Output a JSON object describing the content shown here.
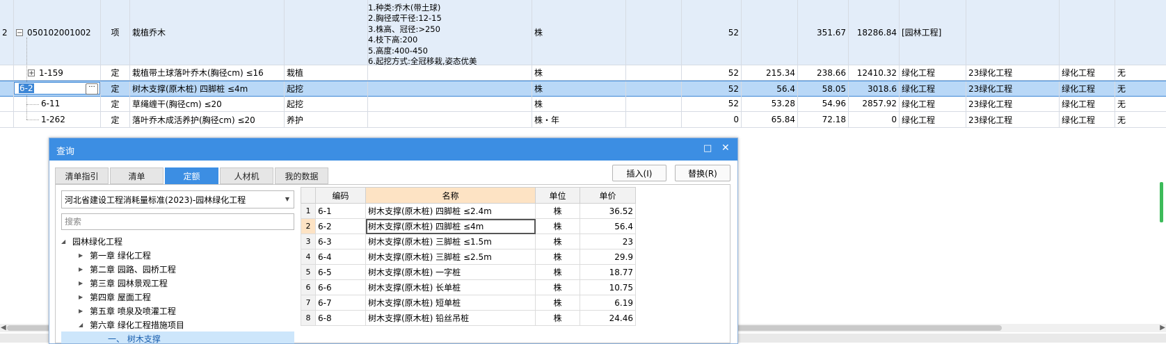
{
  "bill_row": {
    "row_no": "2",
    "code": "050102001002",
    "type": "项",
    "name": "栽植乔木",
    "features": [
      "1.种类:乔木(带土球)",
      "2.胸径或干径:12-15",
      "3.株高、冠径:>250",
      "4.枝下高:200",
      "5.高度:400-450",
      "6.起挖方式:全冠移栽,姿态优美"
    ],
    "unit": "株",
    "qty": "52",
    "unit_price": "351.67",
    "total": "18286.84",
    "category": "[园林工程]"
  },
  "quota_rows": [
    {
      "code": "1-159",
      "type": "定",
      "name": "栽植带土球落叶乔木(胸径cm) ≤16",
      "work": "栽植",
      "unit": "株",
      "qty": "52",
      "price": "215.34",
      "comp": "238.66",
      "total": "12410.32",
      "cat": "绿化工程",
      "prof": "23绿化工程",
      "sub": "绿化工程",
      "extra": "无"
    },
    {
      "code": "6-2",
      "type": "定",
      "name": "树木支撑(原木桩) 四脚桩 ≤4m",
      "work": "起挖",
      "unit": "株",
      "qty": "52",
      "price": "56.4",
      "comp": "58.05",
      "total": "3018.6",
      "cat": "绿化工程",
      "prof": "23绿化工程",
      "sub": "绿化工程",
      "extra": "无"
    },
    {
      "code": "6-11",
      "type": "定",
      "name": "草绳缠干(胸径cm) ≤20",
      "work": "起挖",
      "unit": "株",
      "qty": "52",
      "price": "53.28",
      "comp": "54.96",
      "total": "2857.92",
      "cat": "绿化工程",
      "prof": "23绿化工程",
      "sub": "绿化工程",
      "extra": "无"
    },
    {
      "code": "1-262",
      "type": "定",
      "name": "落叶乔木成活养护(胸径cm) ≤20",
      "work": "养护",
      "unit": "株・年",
      "qty": "0",
      "price": "65.84",
      "comp": "72.18",
      "total": "0",
      "cat": "绿化工程",
      "prof": "23绿化工程",
      "sub": "绿化工程",
      "extra": "无"
    }
  ],
  "edit_cell": {
    "value": "6-2",
    "button": "···"
  },
  "dialog": {
    "title": "查询",
    "maximize_icon": "□",
    "close_icon": "✕",
    "tabs": [
      "清单指引",
      "清单",
      "定额",
      "人材机",
      "我的数据"
    ],
    "active_tab": "定额",
    "insert_label": "插入(I)",
    "replace_label": "替换(R)",
    "library": "河北省建设工程消耗量标准(2023)-园林绿化工程",
    "search_placeholder": "搜索",
    "tree": [
      {
        "label": "园林绿化工程",
        "level": 0,
        "expanded": true
      },
      {
        "label": "第一章 绿化工程",
        "level": 1
      },
      {
        "label": "第二章 园路、园桥工程",
        "level": 1
      },
      {
        "label": "第三章 园林景观工程",
        "level": 1
      },
      {
        "label": "第四章 屋面工程",
        "level": 1
      },
      {
        "label": "第五章 喷泉及喷灌工程",
        "level": 1
      },
      {
        "label": "第六章 绿化工程措施项目",
        "level": 1,
        "expanded": true
      },
      {
        "label": "一、 树木支撑",
        "level": 2,
        "selected": true
      }
    ],
    "table_headers": [
      "编码",
      "名称",
      "单位",
      "单价"
    ],
    "table_rows": [
      {
        "n": "1",
        "code": "6-1",
        "name": "树木支撑(原木桩) 四脚桩 ≤2.4m",
        "unit": "株",
        "price": "36.52"
      },
      {
        "n": "2",
        "code": "6-2",
        "name": "树木支撑(原木桩) 四脚桩 ≤4m",
        "unit": "株",
        "price": "56.4"
      },
      {
        "n": "3",
        "code": "6-3",
        "name": "树木支撑(原木桩) 三脚桩 ≤1.5m",
        "unit": "株",
        "price": "23"
      },
      {
        "n": "4",
        "code": "6-4",
        "name": "树木支撑(原木桩) 三脚桩 ≤2.5m",
        "unit": "株",
        "price": "29.9"
      },
      {
        "n": "5",
        "code": "6-5",
        "name": "树木支撑(原木桩) 一字桩",
        "unit": "株",
        "price": "18.77"
      },
      {
        "n": "6",
        "code": "6-6",
        "name": "树木支撑(原木桩) 长单桩",
        "unit": "株",
        "price": "10.75"
      },
      {
        "n": "7",
        "code": "6-7",
        "name": "树木支撑(原木桩) 短单桩",
        "unit": "株",
        "price": "6.19"
      },
      {
        "n": "8",
        "code": "6-8",
        "name": "树木支撑(原木桩) 铅丝吊桩",
        "unit": "株",
        "price": "24.46"
      }
    ]
  },
  "scroll_left_icon": "◀",
  "scroll_right_icon": "▶",
  "colors": {
    "title_blue": "#3c8ee3",
    "selection": "#b9d8f7",
    "bill_row": "#e3edf9",
    "header_highlight": "#fde3c4"
  }
}
